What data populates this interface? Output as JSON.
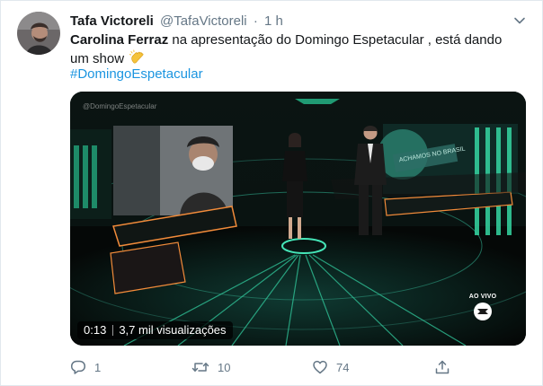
{
  "tweet": {
    "display_name": "Tafa Victoreli",
    "handle": "@TafaVictoreli",
    "separator": "·",
    "time": "1 h",
    "text_bold": "Carolina Ferraz",
    "text_rest": " na apresentação do Domingo Espetacular , está dando um show",
    "emoji": "clapping-hands",
    "hashtag": "#DomingoEspetacular"
  },
  "media": {
    "watermark": "@DomingoEspetacular",
    "screen_text": "ACHAMOS NO BRASIL",
    "live_label": "AO VIVO",
    "elapsed": "0:13",
    "views": "3,7 mil visualizações"
  },
  "actions": {
    "reply_count": "1",
    "retweet_count": "10",
    "like_count": "74"
  },
  "icons": {
    "menu": "chevron-down-icon",
    "reply": "reply-icon",
    "retweet": "retweet-icon",
    "like": "heart-icon",
    "share": "share-icon"
  },
  "colors": {
    "text": "#14171a",
    "secondary": "#657786",
    "link": "#1b95e0",
    "studio_green": "#3fe0b0"
  }
}
